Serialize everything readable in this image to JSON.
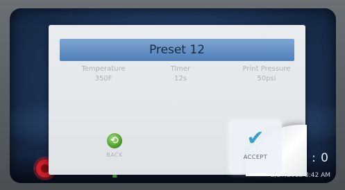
{
  "dialog": {
    "title": "Preset 12",
    "temperature": {
      "label": "Temperature",
      "value": "350F"
    },
    "timer": {
      "label": "Timer",
      "value": "12s"
    },
    "pressure": {
      "label": "Print Pressure",
      "value": "50psi"
    },
    "back_label": "BACK",
    "accept_label": "ACCEPT"
  },
  "status": {
    "counter": "nter : 0",
    "datetime": "2/27/2012 8:42 AM"
  },
  "icons": {
    "logo": "logo-icon",
    "back": "back-arrow-icon",
    "accept": "checkmark-icon",
    "bar": [
      "green-figure-icon",
      "red-x-icon",
      "green-check-icon"
    ]
  },
  "colors": {
    "title_bar": "#5b89c0",
    "accept_check": "#3aa0c8",
    "back_green": "#4f9e2f",
    "cancel_red": "#d8242c"
  }
}
